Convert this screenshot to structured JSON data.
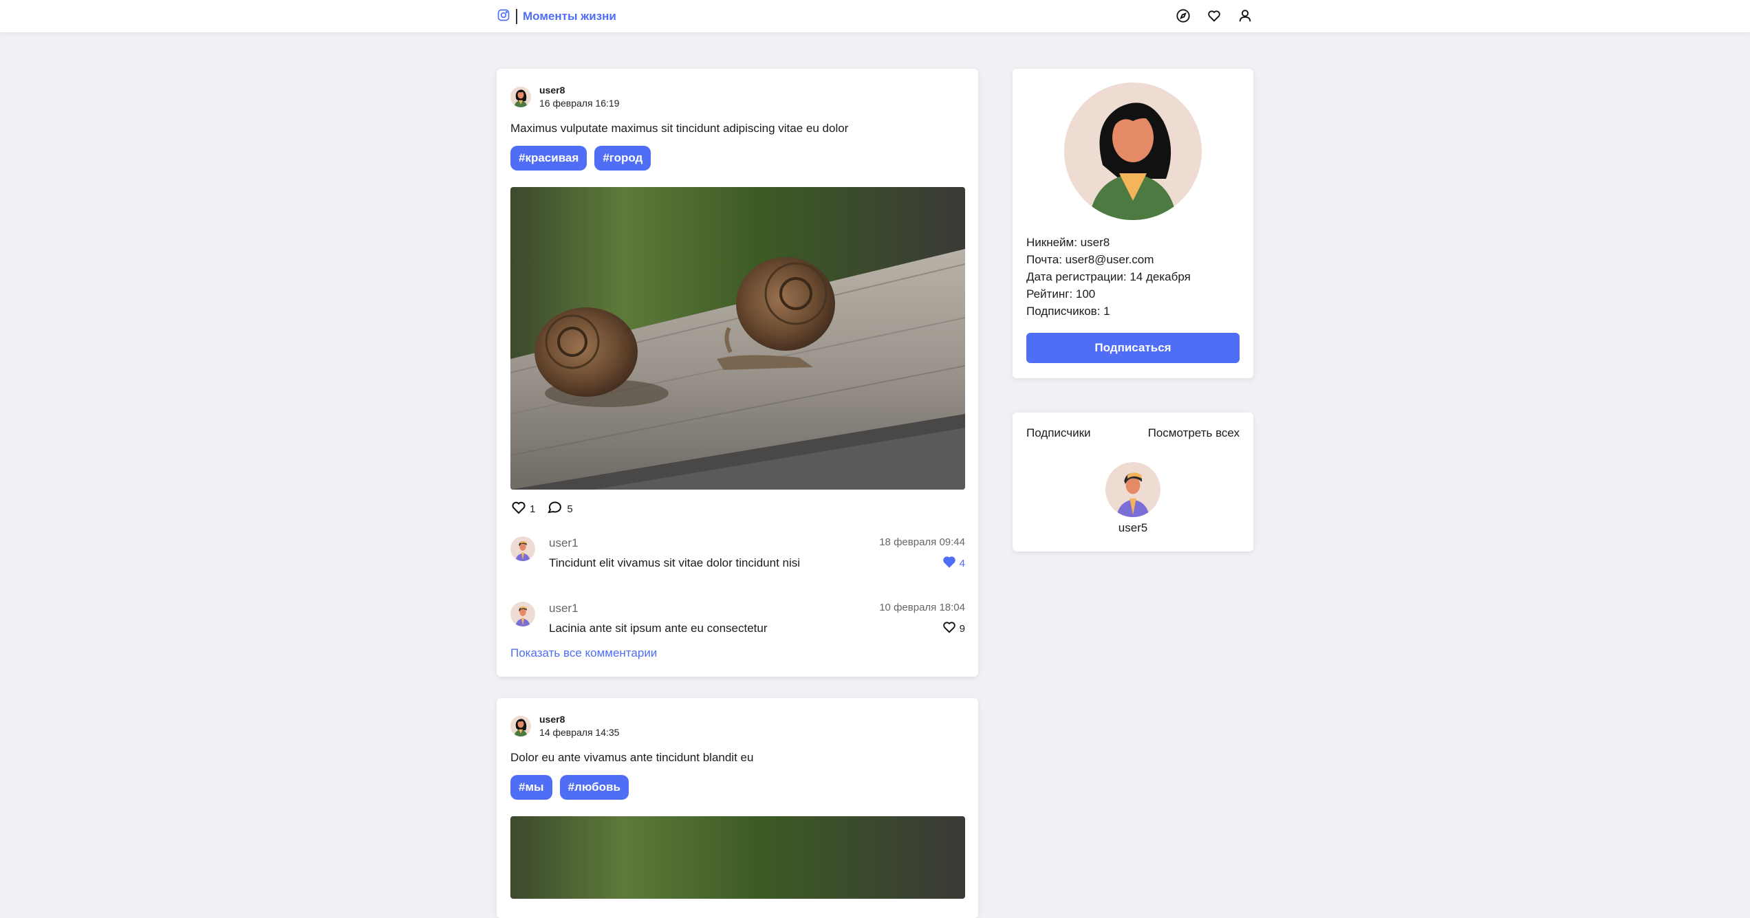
{
  "header": {
    "app_title": "Моменты жизни",
    "logo_icon": "instagram-icon",
    "nav_icons": [
      "compass-icon",
      "heart-icon",
      "user-icon"
    ]
  },
  "posts": [
    {
      "user": "user8",
      "date": "16 февраля 16:19",
      "text": "Maximus vulputate maximus sit tincidunt adipiscing vitae eu dolor",
      "tags": [
        "#красивая",
        "#город"
      ],
      "likes": "1",
      "comments_count": "5",
      "comments": [
        {
          "user": "user1",
          "date": "18 февраля 09:44",
          "text": "Tincidunt elit vivamus sit vitae dolor tincidunt nisi",
          "likes": "4",
          "liked": true
        },
        {
          "user": "user1",
          "date": "10 февраля 18:04",
          "text": "Lacinia ante sit ipsum ante eu consectetur",
          "likes": "9",
          "liked": false
        }
      ],
      "show_all_label": "Показать все комментарии"
    },
    {
      "user": "user8",
      "date": "14 февраля 14:35",
      "text": "Dolor eu ante vivamus ante tincidunt blandit eu",
      "tags": [
        "#мы",
        "#любовь"
      ]
    }
  ],
  "profile": {
    "nickname": "Никнейм: user8",
    "email": "Почта: user8@user.com",
    "registered": "Дата регистрации: 14 декабря",
    "rating": "Рейтинг: 100",
    "followers": "Подписчиков: 1",
    "subscribe_label": "Подписаться"
  },
  "subscribers": {
    "title": "Подписчики",
    "view_all": "Посмотреть всех",
    "users": [
      "user5"
    ]
  },
  "colors": {
    "accent": "#4f6df5",
    "background": "#f0f1f4",
    "card": "#ffffff"
  }
}
